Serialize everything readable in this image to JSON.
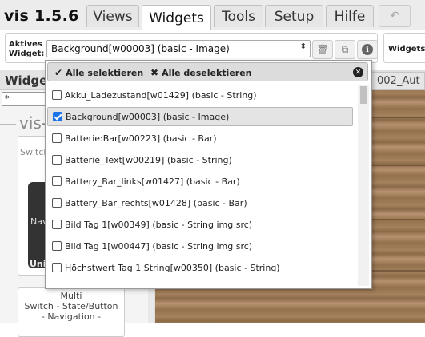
{
  "app": {
    "title": "vis 1.5.6"
  },
  "tabs": [
    {
      "label": "Views"
    },
    {
      "label": "Widgets"
    },
    {
      "label": "Tools"
    },
    {
      "label": "Setup"
    },
    {
      "label": "Hilfe"
    }
  ],
  "active_widget": {
    "label_line1": "Aktives",
    "label_line2": "Widget:",
    "value": "Background[w00003] (basic - Image)"
  },
  "widgets_group": {
    "label": "Widgets"
  },
  "left_panel": {
    "header": "Widge",
    "filter_value": "*",
    "section": "vis-",
    "card1_label": "Switch",
    "card1_nav": "Nav",
    "card1_uni": "Uni",
    "card2_line1": "Multi",
    "card2_line2": "Switch - State/Button",
    "card2_line3": "- Navigation -"
  },
  "canvas": {
    "view_tab": "002_Aut"
  },
  "dropdown": {
    "select_all": "Alle selektieren",
    "deselect_all": "Alle deselektieren",
    "items": [
      {
        "label": "Akku_Ladezustand[w01429] (basic - String)",
        "checked": false
      },
      {
        "label": "Background[w00003] (basic - Image)",
        "checked": true
      },
      {
        "label": "Batterie:Bar[w00223] (basic - Bar)",
        "checked": false
      },
      {
        "label": "Batterie_Text[w00219] (basic - String)",
        "checked": false
      },
      {
        "label": "Battery_Bar_links[w01427] (basic - Bar)",
        "checked": false
      },
      {
        "label": "Battery_Bar_rechts[w01428] (basic - Bar)",
        "checked": false
      },
      {
        "label": "Bild Tag 1[w00349] (basic - String img src)",
        "checked": false
      },
      {
        "label": "Bild Tag 1[w00447] (basic - String img src)",
        "checked": false
      },
      {
        "label": "Höchstwert Tag 1 String[w00350] (basic - String)",
        "checked": false
      }
    ]
  }
}
